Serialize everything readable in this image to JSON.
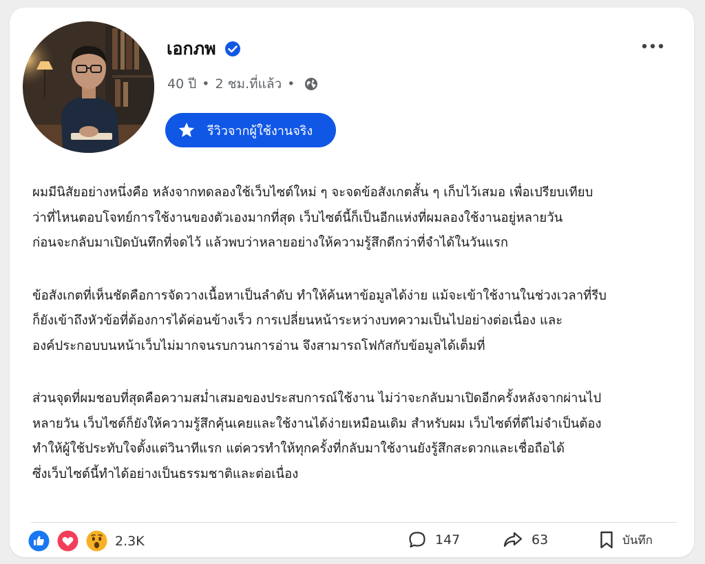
{
  "post": {
    "author": {
      "name": "เอกภพ",
      "verified": true,
      "age": "40 ปี",
      "time": "2 ชม.ที่แล้ว",
      "visibility_icon": "globe-icon"
    },
    "badge": {
      "icon": "star-icon",
      "label": "รีวิวจากผู้ใช้งานจริง"
    },
    "more_icon": "more-horizontal-icon",
    "separator": "•",
    "paragraphs": [
      "ผมมีนิสัยอย่างหนึ่งคือ หลังจากทดลองใช้เว็บไซต์ใหม่ ๆ จะจดข้อสังเกตสั้น ๆ เก็บไว้เสมอ เพื่อเปรียบเทียบ\nว่าที่ไหนตอบโจทย์การใช้งานของตัวเองมากที่สุด เว็บไซต์นี้ก็เป็นอีกแห่งที่ผมลองใช้งานอยู่หลายวัน\nก่อนจะกลับมาเปิดบันทึกที่จดไว้ แล้วพบว่าหลายอย่างให้ความรู้สึกดีกว่าที่จำได้ในวันแรก",
      "ข้อสังเกตที่เห็นชัดคือการจัดวางเนื้อหาเป็นลำดับ ทำให้ค้นหาข้อมูลได้ง่าย แม้จะเข้าใช้งานในช่วงเวลาที่รีบ\nก็ยังเข้าถึงหัวข้อที่ต้องการได้ค่อนข้างเร็ว การเปลี่ยนหน้าระหว่างบทความเป็นไปอย่างต่อเนื่อง และ\nองค์ประกอบบนหน้าเว็บไม่มากจนรบกวนการอ่าน จึงสามารถโฟกัสกับข้อมูลได้เต็มที่",
      "ส่วนจุดที่ผมชอบที่สุดคือความสม่ำเสมอของประสบการณ์ใช้งาน ไม่ว่าจะกลับมาเปิดอีกครั้งหลังจากผ่านไป\nหลายวัน เว็บไซต์ก็ยังให้ความรู้สึกคุ้นเคยและใช้งานได้ง่ายเหมือนเดิม สำหรับผม เว็บไซต์ที่ดีไม่จำเป็นต้อง\nทำให้ผู้ใช้ประทับใจตั้งแต่วินาทีแรก แต่ควรทำให้ทุกครั้งที่กลับมาใช้งานยังรู้สึกสะดวกและเชื่อถือได้\nซึ่งเว็บไซต์นี้ทำได้อย่างเป็นธรรมชาติและต่อเนื่อง"
    ],
    "reactions": {
      "icons": [
        "like-icon",
        "love-icon",
        "wow-icon"
      ],
      "count": "2.3K"
    },
    "actions": {
      "comments": {
        "icon": "comment-icon",
        "count": "147"
      },
      "shares": {
        "icon": "share-icon",
        "count": "63"
      },
      "save": {
        "icon": "bookmark-icon",
        "label": "บันทึก"
      }
    },
    "colors": {
      "accent": "#1057e6",
      "like": "#1877f2",
      "love": "#f33e58",
      "wow": "#f7b125"
    }
  }
}
